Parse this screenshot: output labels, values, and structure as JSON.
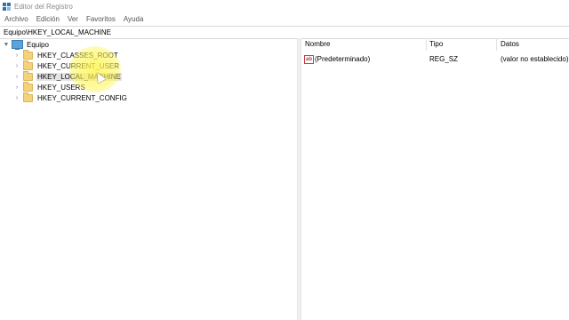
{
  "window": {
    "title": "Editor del Registro"
  },
  "menu": [
    "Archivo",
    "Edición",
    "Ver",
    "Favoritos",
    "Ayuda"
  ],
  "address": {
    "path": "Equipo\\HKEY_LOCAL_MACHINE"
  },
  "tree": {
    "root": "Equipo",
    "children": [
      "HKEY_CLASSES_ROOT",
      "HKEY_CURRENT_USER",
      "HKEY_LOCAL_MACHINE",
      "HKEY_USERS",
      "HKEY_CURRENT_CONFIG"
    ],
    "selected_index": 2
  },
  "list": {
    "columns": [
      "Nombre",
      "Tipo",
      "Datos"
    ],
    "rows": [
      {
        "name": "(Predeterminado)",
        "type": "REG_SZ",
        "data": "(valor no establecido)"
      }
    ]
  },
  "colors": {
    "highlight": "#fff550",
    "selection": "#e5e5e5",
    "folder": "#f3d27a",
    "accent": "#2f6fb3"
  }
}
